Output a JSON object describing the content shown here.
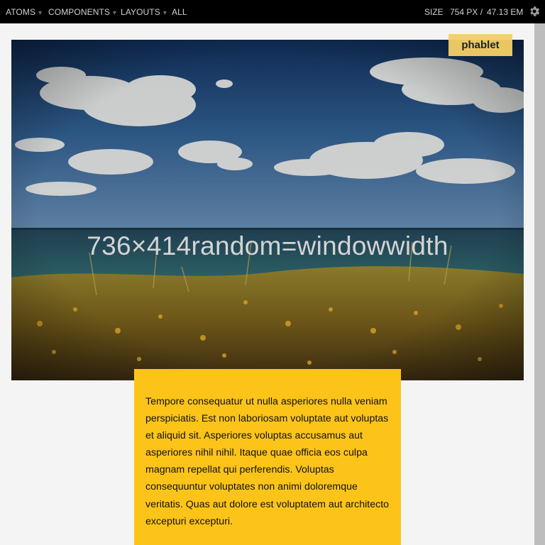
{
  "topbar": {
    "nav": [
      {
        "label": "ATOMS",
        "has_caret": true
      },
      {
        "label": "COMPONENTS",
        "has_caret": true
      },
      {
        "label": "LAYOUTS",
        "has_caret": true
      },
      {
        "label": "ALL",
        "has_caret": false
      }
    ],
    "size_label": "SIZE",
    "size_px": "754 PX /",
    "size_em": "47.13 EM",
    "settings_icon": "gear-icon"
  },
  "badge": {
    "label": "phablet"
  },
  "hero": {
    "caption": "736×414random=windowwidth"
  },
  "content": {
    "paragraph": "Tempore consequatur ut nulla asperiores nulla veniam perspiciatis. Est non laboriosam voluptate aut voluptas et aliquid sit. Asperiores voluptas accusamus aut asperiores nihil nihil. Itaque quae officia eos culpa magnam repellat qui perferendis. Voluptas consequuntur voluptates non animi doloremque veritatis. Quas aut dolore est voluptatem aut architecto excepturi excepturi."
  },
  "colors": {
    "topbar_bg": "#000000",
    "badge_bg": "#f5d066",
    "textbox_bg": "#fcc419",
    "page_bg": "#f4f4f4"
  }
}
